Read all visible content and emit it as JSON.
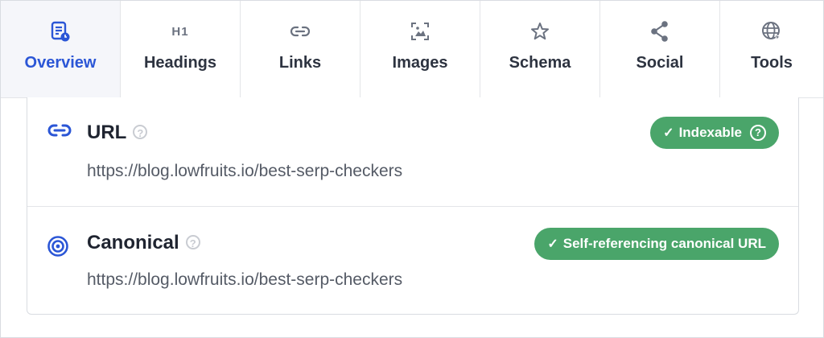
{
  "tabs": [
    {
      "label": "Overview",
      "icon": "report-icon",
      "active": true
    },
    {
      "label": "Headings",
      "icon": "h1-icon",
      "glyph": "H1"
    },
    {
      "label": "Links",
      "icon": "link-icon"
    },
    {
      "label": "Images",
      "icon": "image-icon"
    },
    {
      "label": "Schema",
      "icon": "star-icon"
    },
    {
      "label": "Social",
      "icon": "share-icon"
    },
    {
      "label": "Tools",
      "icon": "globe-icon"
    }
  ],
  "url_row": {
    "title": "URL",
    "help": "?",
    "value": "https://blog.lowfruits.io/best-serp-checkers",
    "badge_check": "✓",
    "badge_label": "Indexable",
    "badge_help": "?"
  },
  "canonical_row": {
    "title": "Canonical",
    "help": "?",
    "value": "https://blog.lowfruits.io/best-serp-checkers",
    "badge_check": "✓",
    "badge_label": "Self-referencing canonical URL"
  },
  "colors": {
    "accent": "#2b56d6",
    "success": "#4aa56a",
    "text": "#1f2430",
    "muted": "#555b66"
  }
}
